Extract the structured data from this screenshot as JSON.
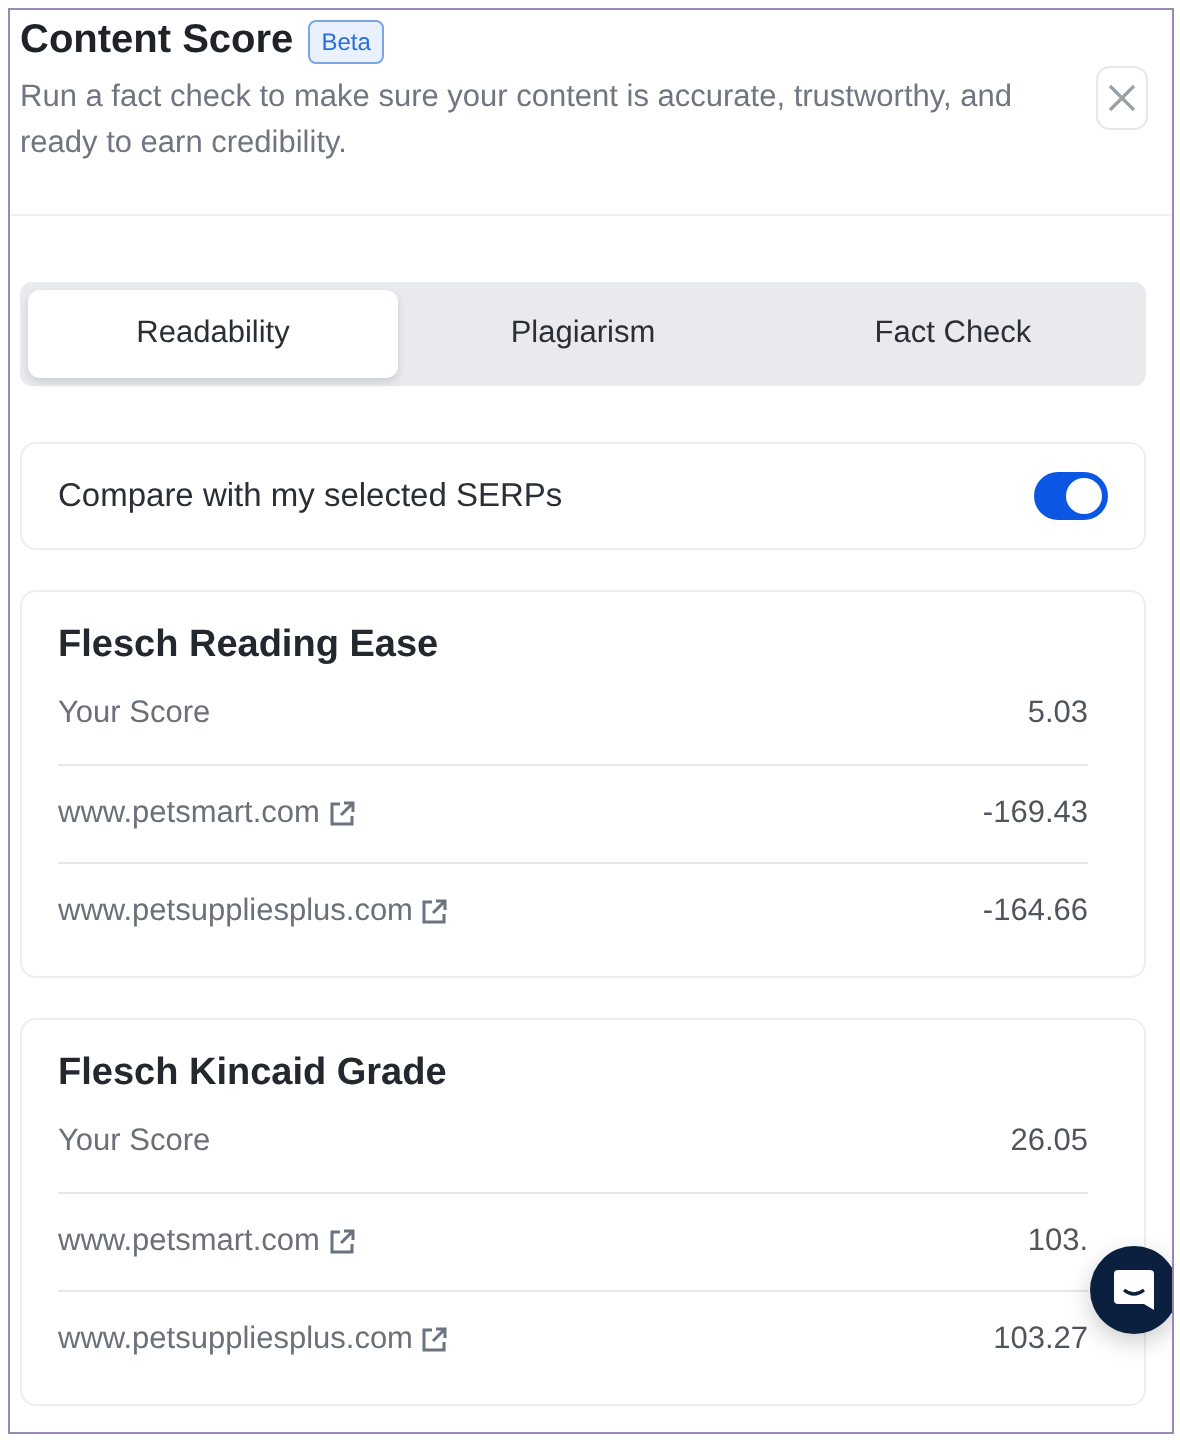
{
  "header": {
    "title": "Content Score",
    "badge": "Beta",
    "description": "Run a fact check to make sure your content is accurate, trustworthy, and ready to earn credibility."
  },
  "tabs": [
    {
      "label": "Readability",
      "selected": true
    },
    {
      "label": "Plagiarism",
      "selected": false
    },
    {
      "label": "Fact Check",
      "selected": false
    }
  ],
  "compare": {
    "label": "Compare with my selected SERPs",
    "on": true
  },
  "metrics": [
    {
      "title": "Flesch Reading Ease",
      "rows": [
        {
          "kind": "score",
          "label": "Your Score",
          "value": "5.03"
        },
        {
          "kind": "link",
          "label": "www.petsmart.com",
          "value": "-169.43"
        },
        {
          "kind": "link",
          "label": "www.petsuppliesplus.com",
          "value": "-164.66"
        }
      ]
    },
    {
      "title": "Flesch Kincaid Grade",
      "rows": [
        {
          "kind": "score",
          "label": "Your Score",
          "value": "26.05"
        },
        {
          "kind": "link",
          "label": "www.petsmart.com",
          "value": "103."
        },
        {
          "kind": "link",
          "label": "www.petsuppliesplus.com",
          "value": "103.27"
        }
      ]
    }
  ]
}
